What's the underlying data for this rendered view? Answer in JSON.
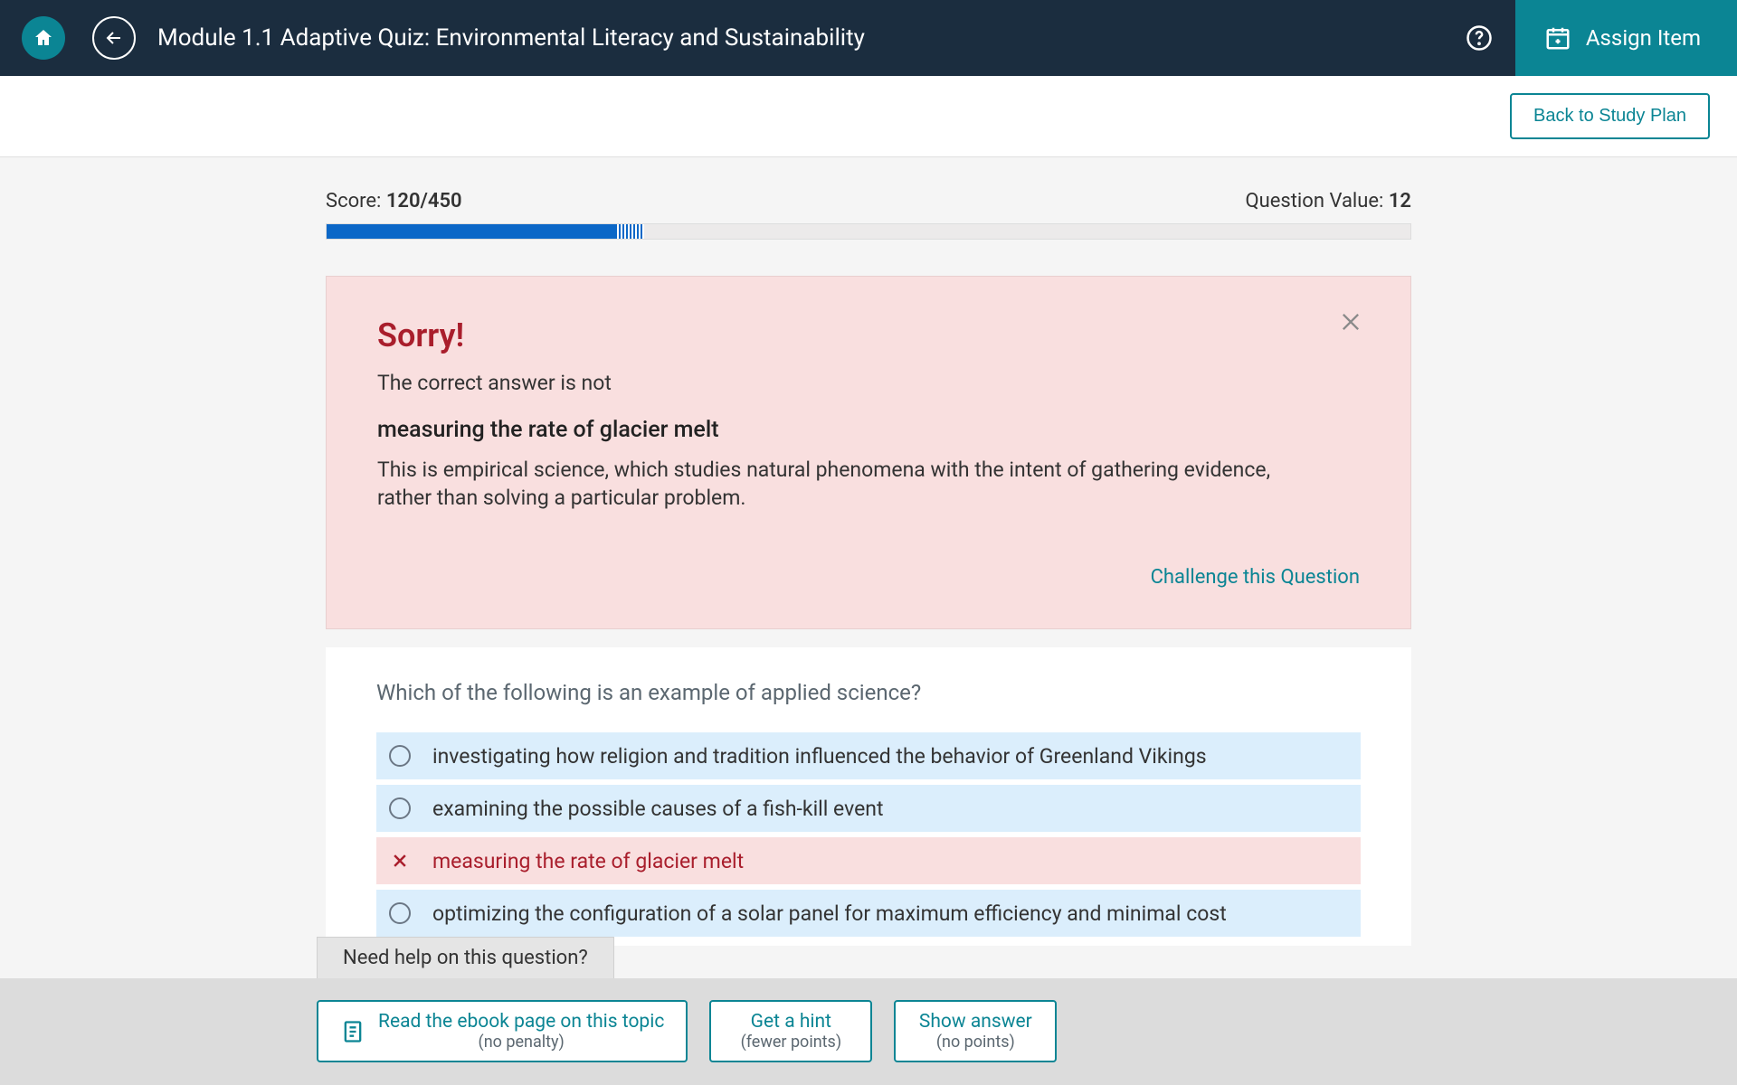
{
  "header": {
    "title": "Module 1.1 Adaptive Quiz: Environmental Literacy and Sustainability",
    "assign_label": "Assign Item"
  },
  "subbar": {
    "back_study_label": "Back to Study Plan"
  },
  "score": {
    "label": "Score: ",
    "value": "120/450",
    "qv_label": "Question Value: ",
    "qv_value": "12",
    "progress_solid_pct": 26.6,
    "progress_stripe_pct": 2.7
  },
  "feedback": {
    "heading": "Sorry!",
    "subtitle": "The correct answer is not",
    "wrong_answer": "measuring the rate of glacier melt",
    "explanation": "This is empirical science, which studies natural phenomena with the intent of gathering evidence, rather than solving a particular problem.",
    "challenge_label": "Challenge this Question"
  },
  "question": {
    "text": "Which of the following is an example of applied science?",
    "options": [
      {
        "label": "investigating how religion and tradition influenced the behavior of Greenland Vikings",
        "state": "normal"
      },
      {
        "label": "examining the possible causes of a fish-kill event",
        "state": "normal"
      },
      {
        "label": "measuring the rate of glacier melt",
        "state": "wrong"
      },
      {
        "label": "optimizing the configuration of a solar panel for maximum efficiency and minimal cost",
        "state": "normal"
      }
    ]
  },
  "help": {
    "tab_label": "Need help on this question?",
    "ebook_main": "Read the ebook page on this topic",
    "ebook_sub": "(no penalty)",
    "hint_main": "Get a hint",
    "hint_sub": "(fewer points)",
    "show_main": "Show answer",
    "show_sub": "(no points)"
  }
}
